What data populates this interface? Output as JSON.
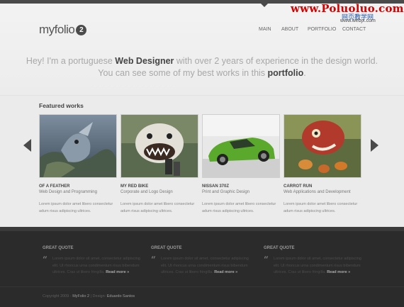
{
  "watermark": {
    "title": "www.Poluoluo.com",
    "subtitle": "网页教学网",
    "url": "www.webjx.com"
  },
  "logo": {
    "text": "myfolio",
    "badge": "2"
  },
  "nav": {
    "items": [
      "MAIN",
      "ABOUT",
      "PORTFOLIO",
      "CONTACT"
    ]
  },
  "intro": {
    "p1_a": "Hey! I'm a portuguese ",
    "p1_b": "Web Designer",
    "p1_c": " with over 2 years of experience in the design world.",
    "p2_a": "You can see some of my best works in this ",
    "p2_b": "portfolio",
    "p2_c": "."
  },
  "featured": {
    "title": "Featured works",
    "items": [
      {
        "title": "OF A FEATHER",
        "subtitle": "Web Design and Programming",
        "desc1": "Lorem ipsum dolor amet libero consectetur",
        "desc2": "adum risus adipiscing ultrices."
      },
      {
        "title": "MY RED BIKE",
        "subtitle": "Corporate and Logo Design",
        "desc1": "Lorem ipsum dolor amet libero consectetur",
        "desc2": "adum risus adipiscing ultrices."
      },
      {
        "title": "NISSAN 370Z",
        "subtitle": "Print and Graphic Design",
        "desc1": "Lorem ipsum dolor amet libero consectetur",
        "desc2": "adum risus adipiscing ultrices."
      },
      {
        "title": "CARROT RUN",
        "subtitle": "Web Applications and Development",
        "desc1": "Lorem ipsum dolor amet libero consectetur",
        "desc2": "adum risus adipiscing ultrices."
      }
    ]
  },
  "quotes": [
    {
      "title": "GREAT QUOTE",
      "text": "Lorem ipsum dolor sit amet, consectetur adipiscing elit. Ut rhoncus urna condimentum risus bibendum ultrices. Cras ut libero fringilla. ",
      "more": "Read more »"
    },
    {
      "title": "GREAT QUOTE",
      "text": "Lorem ipsum dolor sit amet, consectetur adipiscing elit. Ut rhoncus urna condimentum risus bibendum ultrices. Cras ut libero fringilla. ",
      "more": "Read more »"
    },
    {
      "title": "GREAT QUOTE",
      "text": "Lorem ipsum dolor sit amet, consectetur adipiscing elit. Ut rhoncus urna condimentum risus bibendum ultrices. Cras ut libero fringilla. ",
      "more": "Read more »"
    }
  ],
  "footer": {
    "copyright": "Copyright 2009 - ",
    "brand": "MyFolio 2",
    "sep": "  |  Design: ",
    "designer": "Eduardo Santos"
  },
  "icons": [
    "arrow-left-icon",
    "arrow-right-icon",
    "quote-icon"
  ],
  "colors": {
    "accent": "#4b4b4b",
    "watermark_red": "#d60000",
    "footer_bg": "#2b2b2b"
  }
}
